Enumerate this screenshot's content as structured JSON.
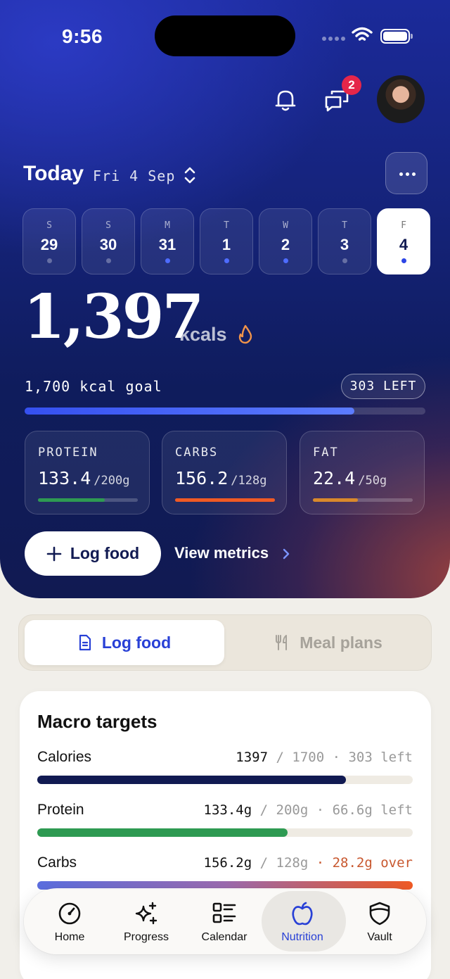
{
  "status_bar": {
    "time": "9:56"
  },
  "header": {
    "notifications_count": "2"
  },
  "date": {
    "title": "Today",
    "subtitle": "Fri 4 Sep"
  },
  "days": [
    {
      "letter": "S",
      "num": "29",
      "dot": "grey"
    },
    {
      "letter": "S",
      "num": "30",
      "dot": "grey"
    },
    {
      "letter": "M",
      "num": "31",
      "dot": "blue"
    },
    {
      "letter": "T",
      "num": "1",
      "dot": "blue"
    },
    {
      "letter": "W",
      "num": "2",
      "dot": "blue"
    },
    {
      "letter": "T",
      "num": "3",
      "dot": "grey"
    },
    {
      "letter": "F",
      "num": "4",
      "dot": "blue",
      "selected": true
    }
  ],
  "calories": {
    "value": "1,397",
    "unit": "kcals",
    "goal_text": "1,700 kcal goal",
    "left_text": "303 LEFT",
    "progress": 0.822
  },
  "macros": [
    {
      "label": "PROTEIN",
      "value": "133.4",
      "target": "/200g",
      "progress": 0.667,
      "color": "#2e9a52"
    },
    {
      "label": "CARBS",
      "value": "156.2",
      "target": "/128g",
      "progress": 1.0,
      "color": "#f05a24"
    },
    {
      "label": "FAT",
      "value": "22.4",
      "target": "/50g",
      "progress": 0.448,
      "color": "#d9892b"
    }
  ],
  "actions": {
    "log_food": "Log food",
    "view_metrics": "View metrics"
  },
  "segmented": {
    "active": "Log food",
    "inactive": "Meal plans"
  },
  "macro_targets": {
    "title": "Macro targets",
    "rows": [
      {
        "label": "Calories",
        "value": "1397",
        "sep": " / ",
        "target": "1700",
        "dot": " · ",
        "remain": "303 left",
        "over": false,
        "progress": 0.822
      },
      {
        "label": "Protein",
        "value": "133.4g",
        "sep": " / ",
        "target": "200g",
        "dot": " · ",
        "remain": "66.6g left",
        "over": false,
        "progress": 0.667
      },
      {
        "label": "Carbs",
        "value": "156.2g",
        "sep": " / ",
        "target": "128g",
        "dot": " · ",
        "remain": "28.2g over",
        "over": true,
        "progress": 1.0
      }
    ]
  },
  "tabs": [
    {
      "label": "Home",
      "icon": "gauge-icon"
    },
    {
      "label": "Progress",
      "icon": "sparkles-icon"
    },
    {
      "label": "Calendar",
      "icon": "list-icon"
    },
    {
      "label": "Nutrition",
      "icon": "apple-icon",
      "active": true
    },
    {
      "label": "Vault",
      "icon": "shield-icon"
    }
  ],
  "colors": {
    "accent": "#2840d6",
    "hero_navy": "#111a52",
    "protein": "#2e9a52",
    "carbs": "#f05a24",
    "fat": "#d9892b",
    "over": "#c8582f"
  }
}
